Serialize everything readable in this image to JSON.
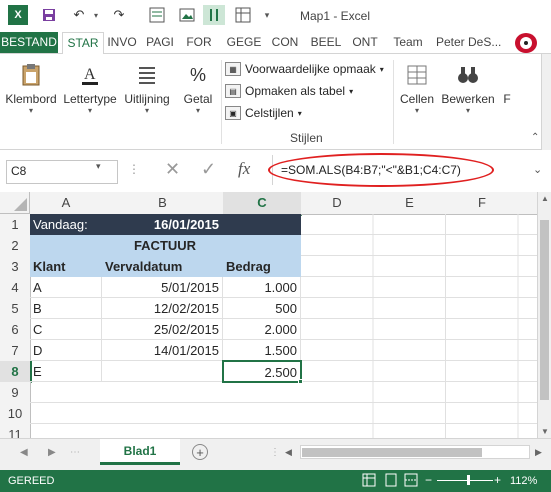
{
  "window": {
    "title": "Map1 - Excel"
  },
  "tabs": [
    "BESTAND",
    "STAR",
    "INVO",
    "PAGI",
    "FOR",
    "GEGE",
    "CON",
    "BEEL",
    "ONT",
    "Team"
  ],
  "user": "Peter DeS...",
  "ribbon": {
    "groups": {
      "clipboard": "Klembord",
      "font": "Lettertype",
      "alignment": "Uitlijning",
      "number": "Getal",
      "cells": "Cellen",
      "editing": "Bewerken",
      "overflow": "F"
    },
    "styles": {
      "conditional": "Voorwaardelijke opmaak",
      "table": "Opmaken als tabel",
      "cell_styles": "Celstijlen",
      "group_label": "Stijlen"
    }
  },
  "formula_bar": {
    "name_box": "C8",
    "formula": "=SOM.ALS(B4:B7;\"<\"&B1;C4:C7)"
  },
  "columns": [
    "A",
    "B",
    "C",
    "D",
    "E",
    "F"
  ],
  "rows": [
    "1",
    "2",
    "3",
    "4",
    "5",
    "6",
    "7",
    "8",
    "9",
    "10",
    "11"
  ],
  "sheet": {
    "header": {
      "label": "Vandaag:",
      "date": "16/01/2015"
    },
    "title": "FACTUUR",
    "col_headers": [
      "Klant",
      "Vervaldatum",
      "Bedrag"
    ],
    "data_rows": [
      [
        "A",
        "5/01/2015",
        "1.000"
      ],
      [
        "B",
        "12/02/2015",
        "500"
      ],
      [
        "C",
        "25/02/2015",
        "2.000"
      ],
      [
        "D",
        "14/01/2015",
        "1.500"
      ]
    ],
    "result_row": [
      "E",
      "",
      "2.500"
    ]
  },
  "sheet_tab": "Blad1",
  "status": {
    "ready": "GEREED",
    "zoom": "112%"
  },
  "colors": {
    "excel_green": "#217346",
    "dark_header": "#2f3b4e",
    "light_blue": "#bdd7ee",
    "annotation": "#e02020"
  }
}
